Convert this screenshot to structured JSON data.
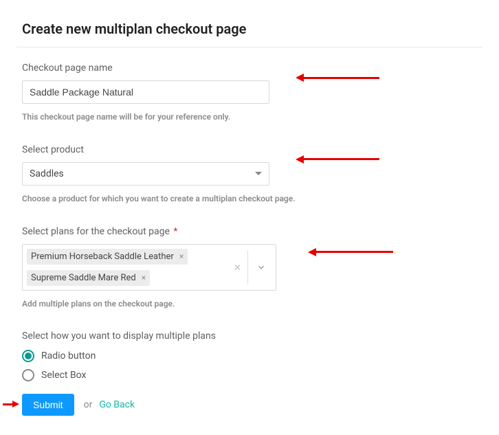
{
  "page": {
    "title": "Create new multiplan checkout page"
  },
  "fields": {
    "name": {
      "label": "Checkout page name",
      "value": "Saddle Package Natural",
      "helper": "This checkout page name will be for your reference only."
    },
    "product": {
      "label": "Select product",
      "value": "Saddles",
      "helper": "Choose a product for which you want to create a multiplan checkout page."
    },
    "plans": {
      "label": "Select plans for the checkout page",
      "required_mark": "*",
      "helper": "Add multiple plans on the checkout page.",
      "selected": [
        "Premium Horseback Saddle Leather",
        "Supreme Saddle Mare Red"
      ]
    },
    "display": {
      "label": "Select how you want to display multiple plans",
      "options": {
        "radio": "Radio button",
        "select": "Select Box"
      },
      "selected": "radio"
    }
  },
  "actions": {
    "submit": "Submit",
    "or": "or",
    "goback": "Go Back"
  },
  "icons": {
    "tag_close": "×",
    "multi_clear": "×"
  }
}
